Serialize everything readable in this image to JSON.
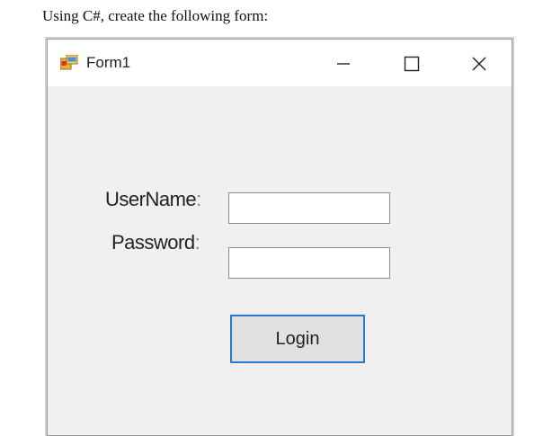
{
  "instruction": "Using C#, create the following form:",
  "window": {
    "title": "Form1",
    "icon": "windows-form-icon",
    "controls": {
      "minimize_icon": "minimize-icon",
      "maximize_icon": "maximize-icon",
      "close_icon": "close-icon"
    }
  },
  "form": {
    "username_label": "UserName",
    "password_label": "Password",
    "colon": ":",
    "username_value": "",
    "password_value": "",
    "login_label": "Login"
  },
  "colors": {
    "window_bg": "#f0f0f0",
    "titlebar_bg": "#ffffff",
    "button_border": "#2b78d4",
    "button_bg": "#e1e1e1"
  }
}
